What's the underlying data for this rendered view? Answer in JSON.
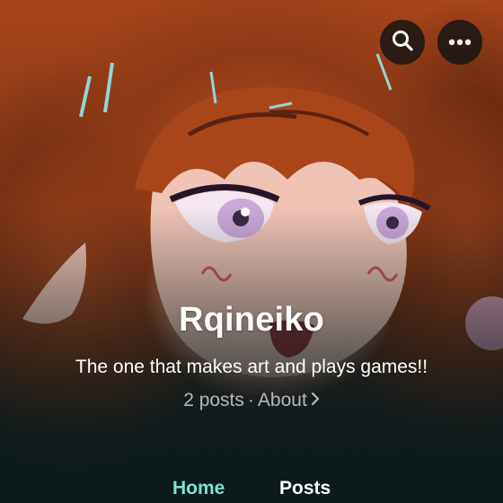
{
  "header": {
    "search_icon": "search-icon",
    "more_icon": "more-horizontal-icon"
  },
  "profile": {
    "name": "Rqineiko",
    "bio": "The one that makes art and plays games!!",
    "posts_count": "2 posts",
    "separator": "·",
    "about_label": "About",
    "about_icon": "chevron-right-icon"
  },
  "tabs": [
    {
      "label": "Home",
      "active": true
    },
    {
      "label": "Posts",
      "active": false
    }
  ],
  "colors": {
    "active_tab": "#7de3d2",
    "background": "#0c1a1c",
    "icon_button_bg": "#141414"
  }
}
